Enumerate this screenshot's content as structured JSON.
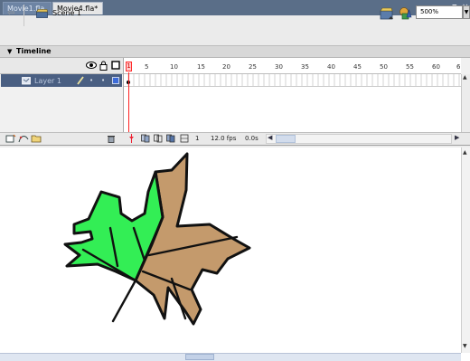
{
  "tabs": [
    {
      "label": "Movie1.fla",
      "active": false
    },
    {
      "label": "Movie4.fla*",
      "active": true
    }
  ],
  "window_controls": {
    "minimize": "–",
    "restore": "🗗",
    "close": "×"
  },
  "scene_bar": {
    "scene_label": "Scene 1",
    "zoom_value": "500%"
  },
  "timeline": {
    "panel_title": "Timeline",
    "frame_numbers": [
      "1",
      "5",
      "10",
      "15",
      "20",
      "25",
      "30",
      "35",
      "40",
      "45",
      "50",
      "55",
      "60",
      "6"
    ],
    "layer": {
      "name": "Layer 1"
    },
    "current_frame": "1",
    "frame_rate": "12.0 fps",
    "elapsed_time": "0.0s"
  },
  "stage": {
    "leaf": {
      "green_fill": "#33ee55",
      "brown_fill": "#c49a6c",
      "stroke": "#111111"
    }
  },
  "colors": {
    "tab_bar": "#5a6e88",
    "selected_layer": "#4a5f82",
    "playhead": "#ff2020"
  }
}
